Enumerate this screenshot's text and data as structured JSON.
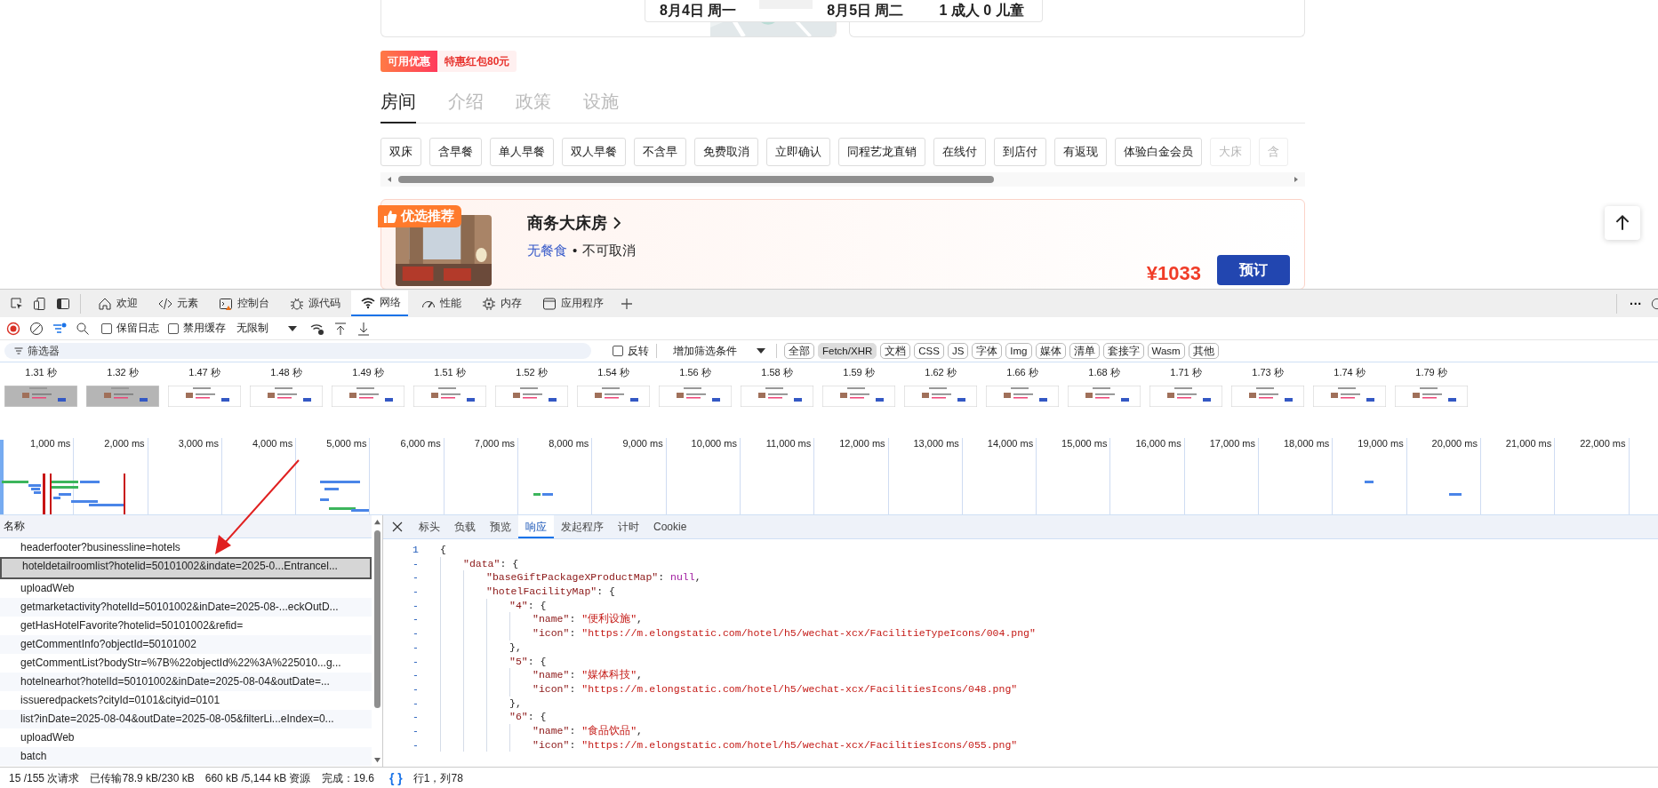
{
  "page": {
    "booking": {
      "checkin": "8月4日 周一",
      "checkout": "8月5日 周二",
      "guests": "1 成人 0 儿童"
    },
    "coupon": {
      "tag": "可用优惠",
      "text": "特惠红包80元"
    },
    "tabs": [
      {
        "label": "房间",
        "selected": true
      },
      {
        "label": "介绍",
        "selected": false
      },
      {
        "label": "政策",
        "selected": false
      },
      {
        "label": "设施",
        "selected": false
      }
    ],
    "filters": [
      {
        "label": "双床",
        "faded": false
      },
      {
        "label": "含早餐",
        "faded": false
      },
      {
        "label": "单人早餐",
        "faded": false
      },
      {
        "label": "双人早餐",
        "faded": false
      },
      {
        "label": "不含早",
        "faded": false
      },
      {
        "label": "免费取消",
        "faded": false
      },
      {
        "label": "立即确认",
        "faded": false
      },
      {
        "label": "同程艺龙直销",
        "faded": false
      },
      {
        "label": "在线付",
        "faded": false
      },
      {
        "label": "到店付",
        "faded": false
      },
      {
        "label": "有返现",
        "faded": false
      },
      {
        "label": "体验白金会员",
        "faded": false
      },
      {
        "label": "大床",
        "faded": true
      },
      {
        "label": "含",
        "faded": true
      }
    ],
    "room": {
      "badge": "优选推荐",
      "name": "商务大床房",
      "meal": "无餐食",
      "separator": "•",
      "cancel": "不可取消",
      "price": "¥1033",
      "book": "预订"
    }
  },
  "devtools": {
    "tabs": [
      {
        "label": "欢迎",
        "selected": false
      },
      {
        "label": "元素",
        "selected": false
      },
      {
        "label": "控制台",
        "selected": false
      },
      {
        "label": "源代码",
        "selected": false
      },
      {
        "label": "网络",
        "selected": true
      },
      {
        "label": "性能",
        "selected": false
      },
      {
        "label": "内存",
        "selected": false
      },
      {
        "label": "应用程序",
        "selected": false
      }
    ],
    "more": "···",
    "toolbar": {
      "preserve_log": {
        "label": "保留日志",
        "checked": false
      },
      "disable_cache": {
        "label": "禁用缓存",
        "checked": false
      },
      "throttle": "无限制"
    },
    "filter": {
      "placeholder": "筛选器",
      "invert": {
        "label": "反转",
        "checked": false
      },
      "more_filters": "增加筛选条件",
      "types": [
        {
          "label": "全部",
          "selected": false
        },
        {
          "label": "Fetch/XHR",
          "selected": true
        },
        {
          "label": "文档",
          "selected": false
        },
        {
          "label": "CSS",
          "selected": false
        },
        {
          "label": "JS",
          "selected": false
        },
        {
          "label": "字体",
          "selected": false
        },
        {
          "label": "Img",
          "selected": false
        },
        {
          "label": "媒体",
          "selected": false
        },
        {
          "label": "清单",
          "selected": false
        },
        {
          "label": "套接字",
          "selected": false
        },
        {
          "label": "Wasm",
          "selected": false
        },
        {
          "label": "其他",
          "selected": false
        }
      ]
    },
    "screenshots": [
      {
        "time": "1.31 秒",
        "highlighted": true
      },
      {
        "time": "1.32 秒",
        "highlighted": true
      },
      {
        "time": "1.47 秒",
        "highlighted": false
      },
      {
        "time": "1.48 秒",
        "highlighted": false
      },
      {
        "time": "1.49 秒",
        "highlighted": false
      },
      {
        "time": "1.51 秒",
        "highlighted": false
      },
      {
        "time": "1.52 秒",
        "highlighted": false
      },
      {
        "time": "1.54 秒",
        "highlighted": false
      },
      {
        "time": "1.56 秒",
        "highlighted": false
      },
      {
        "time": "1.58 秒",
        "highlighted": false
      },
      {
        "time": "1.59 秒",
        "highlighted": false
      },
      {
        "time": "1.62 秒",
        "highlighted": false
      },
      {
        "time": "1.66 秒",
        "highlighted": false
      },
      {
        "time": "1.68 秒",
        "highlighted": false
      },
      {
        "time": "1.71 秒",
        "highlighted": false
      },
      {
        "time": "1.73 秒",
        "highlighted": false
      },
      {
        "time": "1.74 秒",
        "highlighted": false
      },
      {
        "time": "1.79 秒",
        "highlighted": false
      }
    ],
    "timeline": {
      "ticks": [
        "1,000 ms",
        "2,000 ms",
        "3,000 ms",
        "4,000 ms",
        "5,000 ms",
        "6,000 ms",
        "7,000 ms",
        "8,000 ms",
        "9,000 ms",
        "10,000 ms",
        "11,000 ms",
        "12,000 ms",
        "13,000 ms",
        "14,000 ms",
        "15,000 ms",
        "16,000 ms",
        "17,000 ms",
        "18,000 ms",
        "19,000 ms",
        "20,000 ms",
        "21,000 ms",
        "22,000 ms"
      ]
    },
    "requests": {
      "header": "名称",
      "rows": [
        {
          "name": "headerfooter?businessline=hotels",
          "selected": false
        },
        {
          "name": "hoteldetailroomlist?hotelid=50101002&indate=2025-0...Entrancel...",
          "selected": true
        },
        {
          "name": "uploadWeb",
          "selected": false
        },
        {
          "name": "getmarketactivity?hotelId=50101002&inDate=2025-08-...eckOutD...",
          "selected": false
        },
        {
          "name": "getHasHotelFavorite?hotelid=50101002&refid=",
          "selected": false
        },
        {
          "name": "getCommentInfo?objectId=50101002",
          "selected": false
        },
        {
          "name": "getCommentList?bodyStr=%7B%22objectId%22%3A%225010...g...",
          "selected": false
        },
        {
          "name": "hotelnearhot?hotelId=50101002&inDate=2025-08-04&outDate=...",
          "selected": false
        },
        {
          "name": "issueredpackets?cityId=0101&cityid=0101",
          "selected": false
        },
        {
          "name": "list?inDate=2025-08-04&outDate=2025-08-05&filterLi...eIndex=0...",
          "selected": false
        },
        {
          "name": "uploadWeb",
          "selected": false
        },
        {
          "name": "batch",
          "selected": false
        }
      ]
    },
    "detail": {
      "tabs": [
        {
          "label": "标头",
          "selected": false
        },
        {
          "label": "负载",
          "selected": false
        },
        {
          "label": "预览",
          "selected": false
        },
        {
          "label": "响应",
          "selected": true
        },
        {
          "label": "发起程序",
          "selected": false
        },
        {
          "label": "计时",
          "selected": false
        },
        {
          "label": "Cookie",
          "selected": false
        }
      ],
      "lines": [
        {
          "gutter": "1",
          "parts": [
            {
              "kind": "punct",
              "text": "{"
            }
          ],
          "children": [
            {
              "gutter": "-",
              "parts": [
                {
                  "kind": "key",
                  "text": "\"data\""
                },
                {
                  "kind": "punct",
                  "text": ": {"
                }
              ],
              "children": [
                {
                  "gutter": "-",
                  "parts": [
                    {
                      "kind": "key",
                      "text": "\"baseGiftPackageXProductMap\""
                    },
                    {
                      "kind": "punct",
                      "text": ": "
                    },
                    {
                      "kind": "null",
                      "text": "null"
                    },
                    {
                      "kind": "punct",
                      "text": ","
                    }
                  ]
                },
                {
                  "gutter": "-",
                  "parts": [
                    {
                      "kind": "key",
                      "text": "\"hotelFacilityMap\""
                    },
                    {
                      "kind": "punct",
                      "text": ": {"
                    }
                  ],
                  "children": [
                    {
                      "gutter": "-",
                      "parts": [
                        {
                          "kind": "key",
                          "text": "\"4\""
                        },
                        {
                          "kind": "punct",
                          "text": ": {"
                        }
                      ],
                      "children": [
                        {
                          "gutter": "-",
                          "parts": [
                            {
                              "kind": "key",
                              "text": "\"name\""
                            },
                            {
                              "kind": "punct",
                              "text": ": "
                            },
                            {
                              "kind": "str",
                              "text": "\"便利设施\""
                            },
                            {
                              "kind": "punct",
                              "text": ","
                            }
                          ]
                        },
                        {
                          "gutter": "-",
                          "parts": [
                            {
                              "kind": "key",
                              "text": "\"icon\""
                            },
                            {
                              "kind": "punct",
                              "text": ": "
                            },
                            {
                              "kind": "str",
                              "text": "\"https://m.elongstatic.com/hotel/h5/wechat-xcx/FacilitieTypeIcons/004.png\""
                            }
                          ]
                        }
                      ]
                    },
                    {
                      "gutter": "-",
                      "parts": [
                        {
                          "kind": "punct",
                          "text": "},"
                        }
                      ]
                    },
                    {
                      "gutter": "-",
                      "parts": [
                        {
                          "kind": "key",
                          "text": "\"5\""
                        },
                        {
                          "kind": "punct",
                          "text": ": {"
                        }
                      ],
                      "children": [
                        {
                          "gutter": "-",
                          "parts": [
                            {
                              "kind": "key",
                              "text": "\"name\""
                            },
                            {
                              "kind": "punct",
                              "text": ": "
                            },
                            {
                              "kind": "str",
                              "text": "\"媒体科技\""
                            },
                            {
                              "kind": "punct",
                              "text": ","
                            }
                          ]
                        },
                        {
                          "gutter": "-",
                          "parts": [
                            {
                              "kind": "key",
                              "text": "\"icon\""
                            },
                            {
                              "kind": "punct",
                              "text": ": "
                            },
                            {
                              "kind": "str",
                              "text": "\"https://m.elongstatic.com/hotel/h5/wechat-xcx/FacilitiesIcons/048.png\""
                            }
                          ]
                        }
                      ]
                    },
                    {
                      "gutter": "-",
                      "parts": [
                        {
                          "kind": "punct",
                          "text": "},"
                        }
                      ]
                    },
                    {
                      "gutter": "-",
                      "parts": [
                        {
                          "kind": "key",
                          "text": "\"6\""
                        },
                        {
                          "kind": "punct",
                          "text": ": {"
                        }
                      ],
                      "children": [
                        {
                          "gutter": "-",
                          "parts": [
                            {
                              "kind": "key",
                              "text": "\"name\""
                            },
                            {
                              "kind": "punct",
                              "text": ": "
                            },
                            {
                              "kind": "str",
                              "text": "\"食品饮品\""
                            },
                            {
                              "kind": "punct",
                              "text": ","
                            }
                          ]
                        },
                        {
                          "gutter": "-",
                          "parts": [
                            {
                              "kind": "key",
                              "text": "\"icon\""
                            },
                            {
                              "kind": "punct",
                              "text": ": "
                            },
                            {
                              "kind": "str",
                              "text": "\"https://m.elongstatic.com/hotel/h5/wechat-xcx/FacilitiesIcons/055.png\""
                            }
                          ]
                        }
                      ]
                    }
                  ]
                }
              ]
            }
          ]
        }
      ]
    },
    "status": {
      "requests": "15 /155 次请求",
      "transferred": "已传输78.9 kB/230 kB",
      "resources": "660 kB /5,144 kB 资源",
      "finish": "完成：19.6",
      "format": "{ }",
      "cursor": "行1，列78"
    }
  }
}
